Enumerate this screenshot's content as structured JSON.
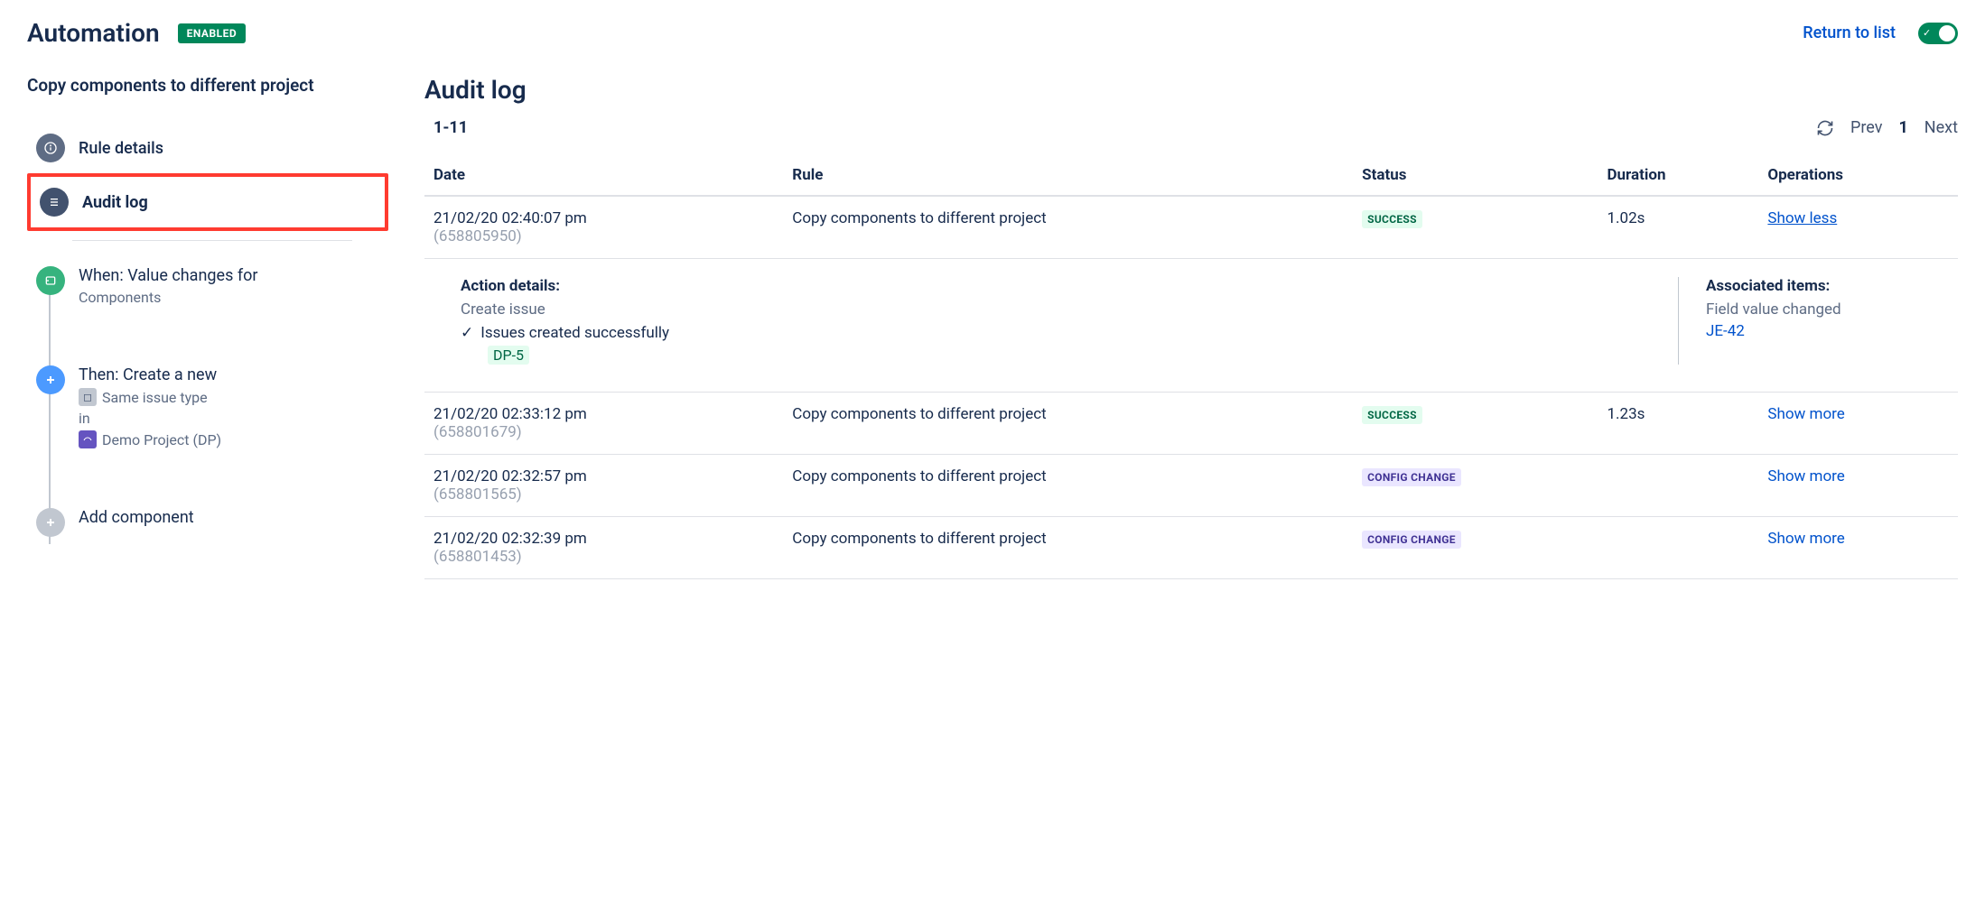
{
  "header": {
    "title": "Automation",
    "enabled_badge": "ENABLED",
    "return_link": "Return to list"
  },
  "rule_name": "Copy components to different project",
  "nav": {
    "rule_details": "Rule details",
    "audit_log": "Audit log"
  },
  "flow": {
    "when_title": "When: Value changes for",
    "when_sub": "Components",
    "then_title": "Then: Create a new",
    "then_sub1": "Same issue type",
    "then_sub_in": "in",
    "then_sub2": "Demo Project (DP)",
    "add_component": "Add component"
  },
  "main": {
    "title": "Audit log",
    "range": "1-11",
    "prev": "Prev",
    "page": "1",
    "next": "Next",
    "columns": {
      "date": "Date",
      "rule": "Rule",
      "status": "Status",
      "duration": "Duration",
      "operations": "Operations"
    },
    "rows": [
      {
        "date": "21/02/20 02:40:07 pm",
        "id": "(658805950)",
        "rule": "Copy components to different project",
        "status": "SUCCESS",
        "status_kind": "success",
        "duration": "1.02s",
        "op": "Show less",
        "op_underline": true,
        "expanded": true
      },
      {
        "date": "21/02/20 02:33:12 pm",
        "id": "(658801679)",
        "rule": "Copy components to different project",
        "status": "SUCCESS",
        "status_kind": "success",
        "duration": "1.23s",
        "op": "Show more"
      },
      {
        "date": "21/02/20 02:32:57 pm",
        "id": "(658801565)",
        "rule": "Copy components to different project",
        "status": "CONFIG CHANGE",
        "status_kind": "config",
        "duration": "",
        "op": "Show more"
      },
      {
        "date": "21/02/20 02:32:39 pm",
        "id": "(658801453)",
        "rule": "Copy components to different project",
        "status": "CONFIG CHANGE",
        "status_kind": "config",
        "duration": "",
        "op": "Show more"
      }
    ],
    "expanded": {
      "action_heading": "Action details:",
      "action_sub": "Create issue",
      "success_msg": "Issues created successfully",
      "issue_key": "DP-5",
      "assoc_heading": "Associated items:",
      "assoc_sub": "Field value changed",
      "assoc_link": "JE-42"
    }
  }
}
